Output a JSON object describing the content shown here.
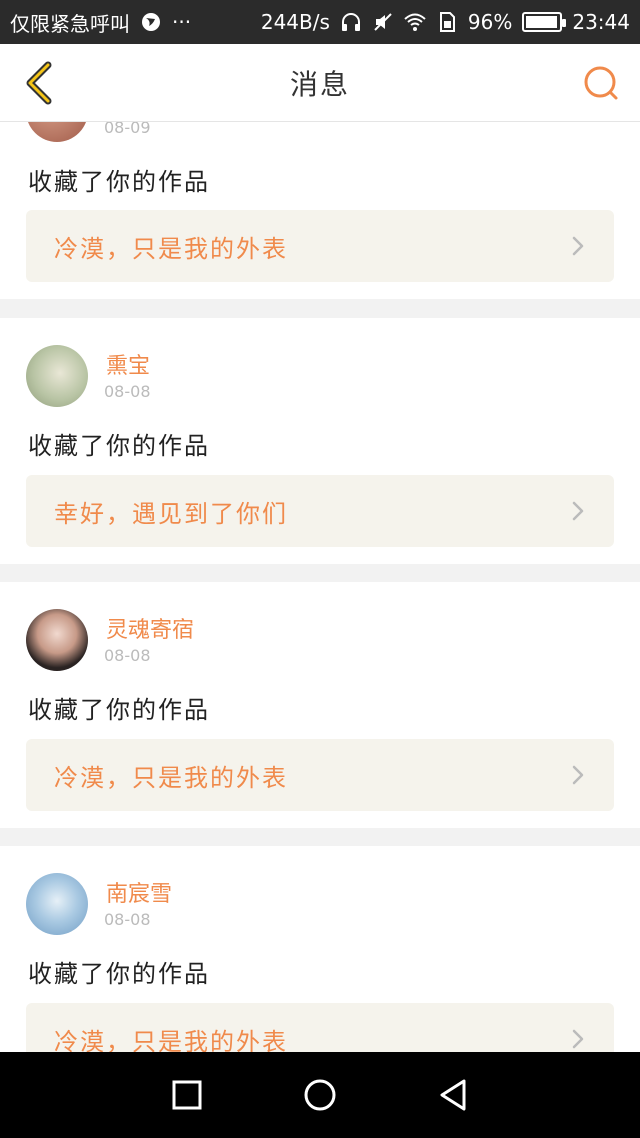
{
  "status_bar": {
    "left_text": "仅限紧急呼叫",
    "more": "···",
    "net_speed": "244B/s",
    "battery_percent": "96%",
    "battery_level": 0.96,
    "time": "23:44"
  },
  "navbar": {
    "title": "消息"
  },
  "colors": {
    "accent": "#f08a4b",
    "work_bg": "#f5f3ec",
    "status_bar": "#2b2b2b"
  },
  "messages": [
    {
      "username": "",
      "date": "08-09",
      "action": "收藏了你的作品",
      "work_title": "冷漠，只是我的外表"
    },
    {
      "username": "熏宝",
      "date": "08-08",
      "action": "收藏了你的作品",
      "work_title": "幸好，遇见到了你们"
    },
    {
      "username": "灵魂寄宿",
      "date": "08-08",
      "action": "收藏了你的作品",
      "work_title": "冷漠，只是我的外表"
    },
    {
      "username": "南宸雪",
      "date": "08-08",
      "action": "收藏了你的作品",
      "work_title": "冷漠，只是我的外表"
    }
  ],
  "icons": {
    "back": "chevron-left-icon",
    "search": "search-icon",
    "work_arrow": "chevron-right-icon",
    "recent": "square-icon",
    "home": "circle-icon",
    "nav_back": "triangle-back-icon"
  }
}
